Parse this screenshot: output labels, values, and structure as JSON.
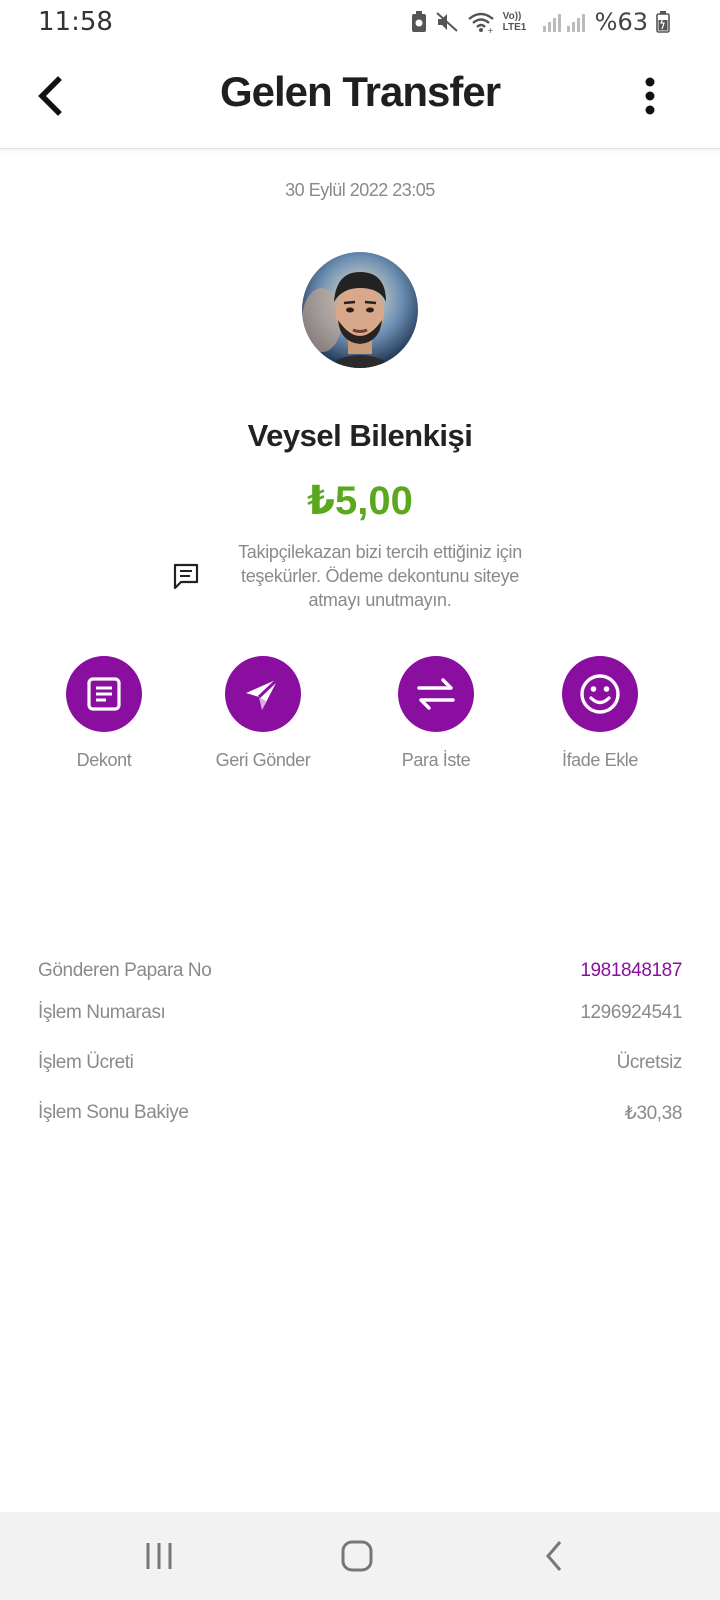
{
  "status_bar": {
    "time": "11:58",
    "battery": "%63",
    "network_label": "Vo)) LTE1",
    "icons": [
      "battery-saver-icon",
      "mute-icon",
      "wifi-icon",
      "signal-icon",
      "battery-icon"
    ]
  },
  "header": {
    "title": "Gelen Transfer",
    "back_icon": "chevron-left-icon",
    "menu_icon": "more-vertical-icon"
  },
  "transfer": {
    "date": "30 Eylül 2022 23:05",
    "sender_name": "Veysel Bilenkişi",
    "amount": "₺5,00",
    "message": "Takipçilekazan bizi tercih ettiğiniz için teşekürler. Ödeme dekontunu siteye atmayı unutmayın."
  },
  "actions": [
    {
      "label": "Dekont",
      "icon": "receipt-icon"
    },
    {
      "label": "Geri Gönder",
      "icon": "send-icon"
    },
    {
      "label": "Para İste",
      "icon": "swap-arrows-icon"
    },
    {
      "label": "İfade Ekle",
      "icon": "smiley-icon"
    }
  ],
  "details": [
    {
      "label": "Gönderen Papara No",
      "value": "1981848187"
    },
    {
      "label": "İşlem Numarası",
      "value": "1296924541"
    },
    {
      "label": "İşlem Ücreti",
      "value": "Ücretsiz"
    },
    {
      "label": "İşlem Sonu Bakiye",
      "value": "₺30,38"
    }
  ],
  "colors": {
    "accent": "#8a0ea0",
    "amount": "#5ba81f",
    "muted_text": "#8a8a8a"
  }
}
